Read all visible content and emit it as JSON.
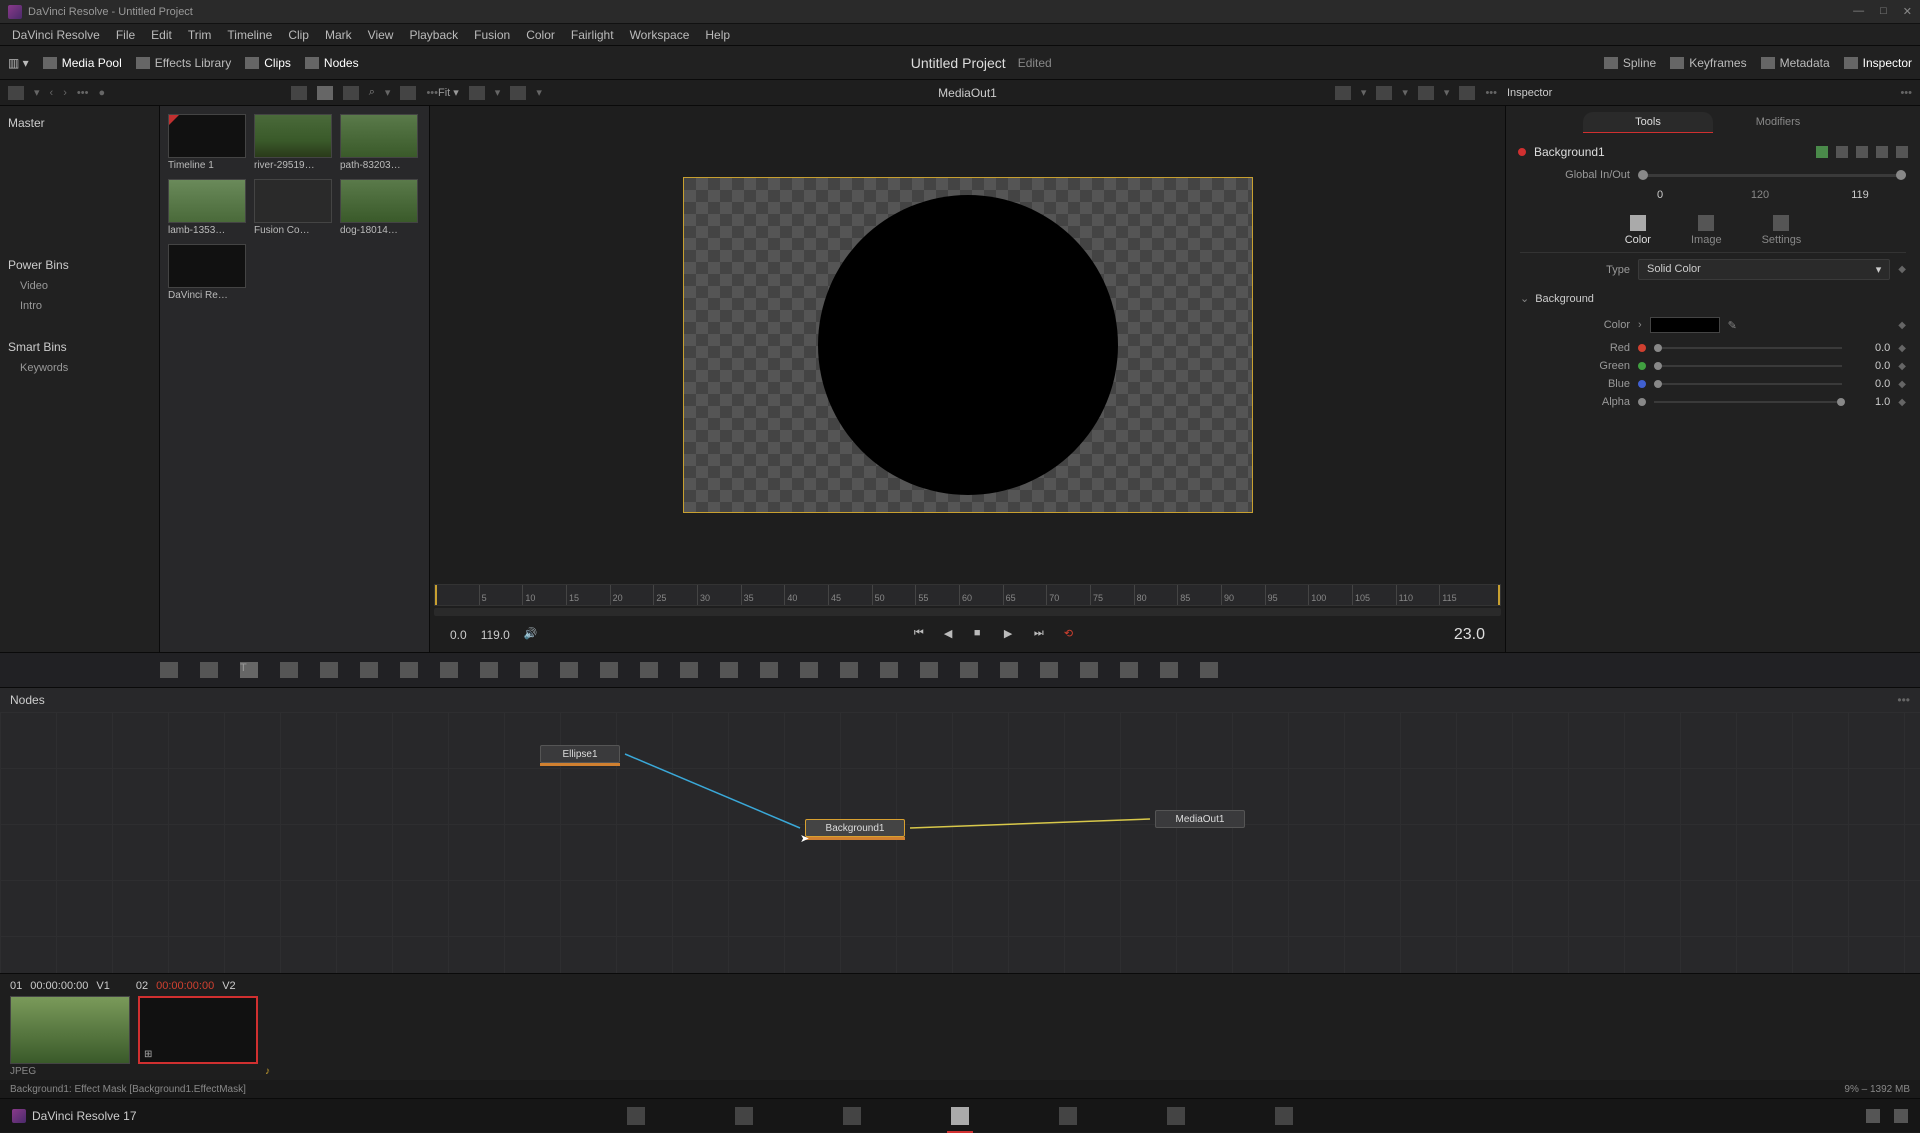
{
  "title": "DaVinci Resolve - Untitled Project",
  "window_controls": {
    "min": "—",
    "max": "□",
    "close": "✕"
  },
  "menu": [
    "DaVinci Resolve",
    "File",
    "Edit",
    "Trim",
    "Timeline",
    "Clip",
    "Mark",
    "View",
    "Playback",
    "Fusion",
    "Color",
    "Fairlight",
    "Workspace",
    "Help"
  ],
  "toolbar": {
    "media_pool": "Media Pool",
    "effects": "Effects Library",
    "clips": "Clips",
    "nodes": "Nodes",
    "spline": "Spline",
    "keyframes": "Keyframes",
    "metadata": "Metadata",
    "inspector": "Inspector"
  },
  "project": {
    "name": "Untitled Project",
    "state": "Edited"
  },
  "secbar": {
    "fit": "Fit ▾",
    "viewer_label": "MediaOut1",
    "inspector_label": "Inspector"
  },
  "left": {
    "master": "Master",
    "powerbins": "Power Bins",
    "video": "Video",
    "intro": "Intro",
    "smartbins": "Smart Bins",
    "keywords": "Keywords"
  },
  "clips": [
    {
      "label": "Timeline 1",
      "cls": "black timeline"
    },
    {
      "label": "river-29519…",
      "cls": "img1"
    },
    {
      "label": "path-83203…",
      "cls": "img2"
    },
    {
      "label": "lamb-1353…",
      "cls": "img3"
    },
    {
      "label": "Fusion Co…",
      "cls": "img4"
    },
    {
      "label": "dog-18014…",
      "cls": "img2"
    },
    {
      "label": "DaVinci Re…",
      "cls": "black"
    }
  ],
  "ruler_ticks": [
    "5",
    "10",
    "15",
    "20",
    "25",
    "30",
    "35",
    "40",
    "45",
    "50",
    "55",
    "60",
    "65",
    "70",
    "75",
    "80",
    "85",
    "90",
    "95",
    "100",
    "105",
    "110",
    "115"
  ],
  "transport": {
    "in": "0.0",
    "out": "119.0",
    "current": "23.0"
  },
  "nodes_title": "Nodes",
  "graph": {
    "ellipse": "Ellipse1",
    "background": "Background1",
    "mediaout": "MediaOut1"
  },
  "bottom": {
    "h1a": "01",
    "h1b": "00:00:00:00",
    "h1c": "V1",
    "h2a": "02",
    "h2b": "00:00:00:00",
    "h2c": "V2",
    "format": "JPEG"
  },
  "status": {
    "left": "Background1: Effect Mask    [Background1.EffectMask]",
    "right": "9% – 1392 MB"
  },
  "pagebar": {
    "label": "DaVinci Resolve 17"
  },
  "inspector": {
    "tabs": {
      "tools": "Tools",
      "modifiers": "Modifiers"
    },
    "node": "Background1",
    "global": "Global In/Out",
    "g_in": "0",
    "g_mid": "120",
    "g_out": "119",
    "subtabs": {
      "color": "Color",
      "image": "Image",
      "settings": "Settings"
    },
    "type_label": "Type",
    "type_value": "Solid Color",
    "section": "Background",
    "color_label": "Color",
    "channels": [
      {
        "name": "Red",
        "color": "#d04030",
        "val": "0.0",
        "pos": "0%"
      },
      {
        "name": "Green",
        "color": "#40a040",
        "val": "0.0",
        "pos": "0%"
      },
      {
        "name": "Blue",
        "color": "#4060d0",
        "val": "0.0",
        "pos": "0%"
      },
      {
        "name": "Alpha",
        "color": "#888",
        "val": "1.0",
        "pos": "97%"
      }
    ]
  }
}
